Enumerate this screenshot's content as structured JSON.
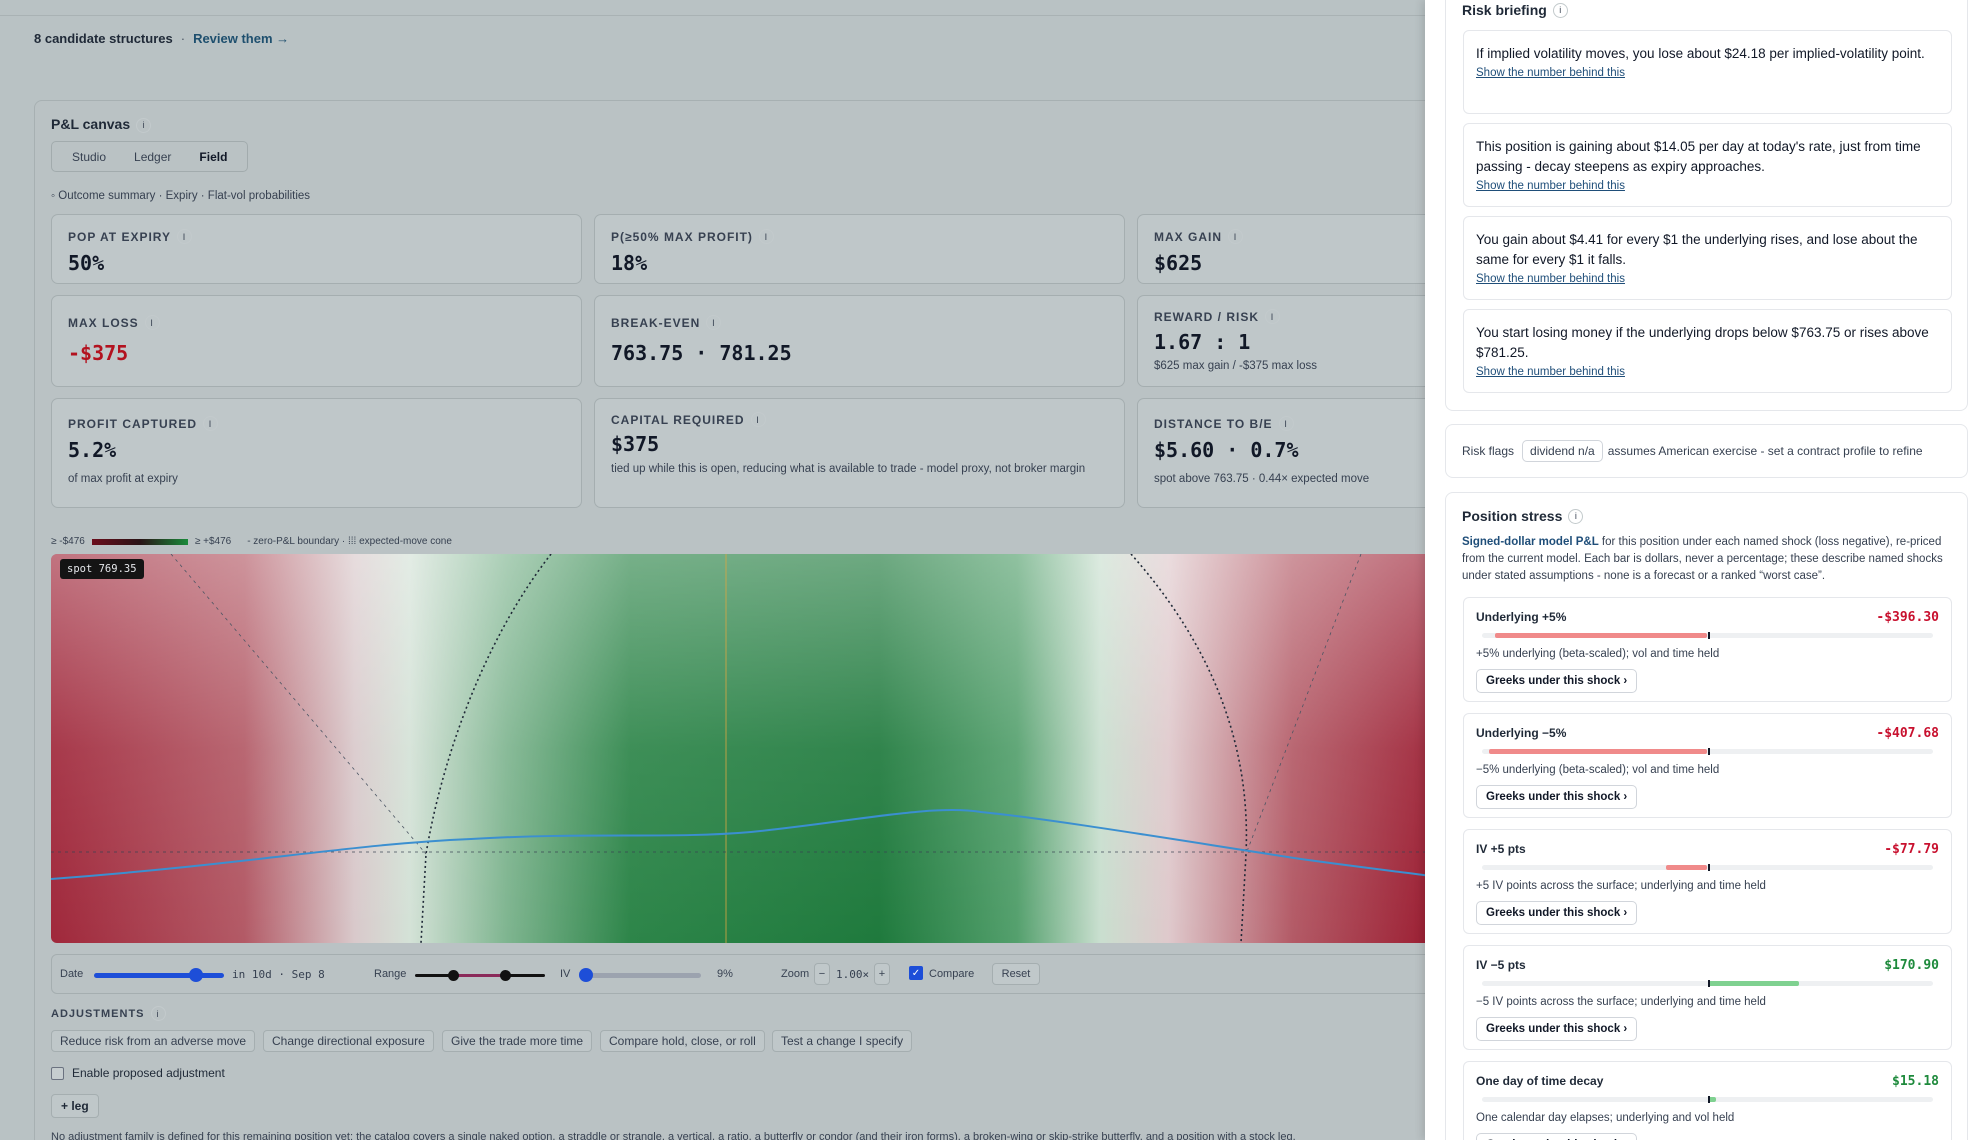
{
  "candidates": {
    "count_label": "8 candidate structures",
    "separator": "·",
    "review_label": "Review them →"
  },
  "canvas": {
    "title": "P&L canvas",
    "views": [
      {
        "label": "Studio"
      },
      {
        "label": "Ledger"
      },
      {
        "label": "Field"
      }
    ],
    "active_view": "Field",
    "outcome_summary": "◦ Outcome summary · Expiry · Flat-vol probabilities"
  },
  "metrics": {
    "pop": {
      "label": "POP AT EXPIRY",
      "value": "50%"
    },
    "p50": {
      "label": "P(≥50% MAX PROFIT)",
      "value": "18%"
    },
    "maxgain": {
      "label": "MAX GAIN",
      "value": "$625"
    },
    "maxloss": {
      "label": "MAX LOSS",
      "value": "-$375"
    },
    "breakeven": {
      "label": "BREAK-EVEN",
      "value": "763.75 · 781.25"
    },
    "rr": {
      "label": "REWARD / RISK",
      "value": "1.67 : 1",
      "sub": "$625 max gain / -$375 max loss"
    },
    "captured": {
      "label": "PROFIT CAPTURED",
      "value": "5.2%",
      "sub": "of max profit at expiry"
    },
    "capital": {
      "label": "CAPITAL REQUIRED",
      "value": "$375",
      "sub": "tied up while this is open, reducing what is available to trade - model proxy, not broker margin"
    },
    "distance": {
      "label": "DISTANCE TO B/E",
      "value": "$5.60 · 0.7%",
      "sub": "spot above 763.75 · 0.44× expected move"
    }
  },
  "heatmap": {
    "legend_low": "≥ -$476",
    "legend_high": "≥ +$476",
    "legend_note": "- zero-P&L boundary · ⁞⁞⁞ expected-move cone",
    "spot_label": "spot 769.35",
    "colors": {
      "loss": "#9c1f33",
      "gain": "#18753a",
      "neutral": "#e6e6e6",
      "pnl_line": "#3b8fd0"
    }
  },
  "controls": {
    "date_label": "Date",
    "date_value": "in 10d · Sep 8",
    "date_fraction": 0.78,
    "range_label": "Range",
    "range_low_fraction": 0.3,
    "range_high_fraction": 0.7,
    "iv_label": "IV",
    "iv_value": "9%",
    "iv_fraction": 0.03,
    "zoom_label": "Zoom",
    "zoom_minus": "−",
    "zoom_value": "1.00×",
    "zoom_plus": "+",
    "compare_label": "Compare",
    "compare_checked": true,
    "reset_label": "Reset"
  },
  "adjustments": {
    "label": "ADJUSTMENTS",
    "chips": [
      {
        "label": "Reduce risk from an adverse move"
      },
      {
        "label": "Change directional exposure"
      },
      {
        "label": "Give the trade more time"
      },
      {
        "label": "Compare hold, close, or roll"
      },
      {
        "label": "Test a change I specify"
      }
    ],
    "enable_label": "Enable proposed adjustment",
    "add_leg_label": "+ leg",
    "note": "No adjustment family is defined for this remaining position yet; the catalog covers a single naked option, a straddle or strangle, a vertical, a ratio, a butterfly or condor (and their iron forms), a broken-wing or skip-strike butterfly, and a position with a stock leg."
  },
  "risk_briefing": {
    "title": "Risk briefing",
    "link_label": "Show the number behind this",
    "items": [
      {
        "text": "If implied volatility moves, you lose about $24.18 per implied-volatility point."
      },
      {
        "text": "This position is gaining about $14.05 per day at today's rate, just from time passing - decay steepens as expiry approaches."
      },
      {
        "text": "You gain about $4.41 for every $1 the underlying rises, and lose about the same for every $1 it falls."
      },
      {
        "text": "You start losing money if the underlying drops below $763.75 or rises above $781.25."
      }
    ]
  },
  "risk_flags": {
    "label": "Risk flags",
    "tag": "dividend n/a",
    "text": "assumes American exercise - set a contract profile to refine"
  },
  "position_stress": {
    "title": "Position stress",
    "intro_bold": "Signed-dollar model P&L",
    "intro": " for this position under each named shock (loss negative), re-priced from the current model. Each bar is dollars, never a percentage; these describe named shocks under stated assumptions - none is a forecast or a ranked “worst case”.",
    "button_label": "Greeks under this shock ›",
    "scale_max": 420,
    "items": [
      {
        "name": "Underlying +5%",
        "value": "-$396.30",
        "amount": -396.3,
        "desc": "+5% underlying (beta-scaled); vol and time held"
      },
      {
        "name": "Underlying −5%",
        "value": "-$407.68",
        "amount": -407.68,
        "desc": "−5% underlying (beta-scaled); vol and time held"
      },
      {
        "name": "IV +5 pts",
        "value": "-$77.79",
        "amount": -77.79,
        "desc": "+5 IV points across the surface; underlying and time held"
      },
      {
        "name": "IV −5 pts",
        "value": "$170.90",
        "amount": 170.9,
        "desc": "−5 IV points across the surface; underlying and time held"
      },
      {
        "name": "One day of time decay",
        "value": "$15.18",
        "amount": 15.18,
        "desc": "One calendar day elapses; underlying and vol held"
      }
    ]
  }
}
